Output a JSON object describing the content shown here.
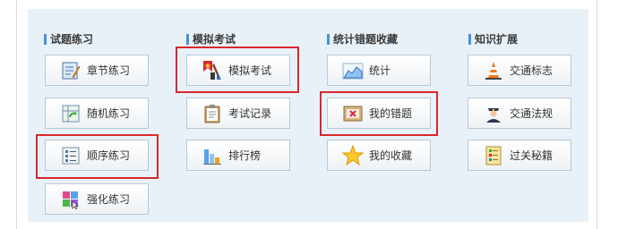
{
  "columns": [
    {
      "title": "试题练习",
      "buttons": [
        {
          "label": "章节练习",
          "icon": "notebook-pencil-icon"
        },
        {
          "label": "随机练习",
          "icon": "shuffle-sheet-icon"
        },
        {
          "label": "顺序练习",
          "icon": "list-icon"
        },
        {
          "label": "强化练习",
          "icon": "puzzle-blocks-icon"
        }
      ]
    },
    {
      "title": "模拟考试",
      "buttons": [
        {
          "label": "模拟考试",
          "icon": "exam-paintbrush-icon"
        },
        {
          "label": "考试记录",
          "icon": "clipboard-icon"
        },
        {
          "label": "排行榜",
          "icon": "bar-chart-icon"
        }
      ]
    },
    {
      "title": "统计错题收藏",
      "buttons": [
        {
          "label": "统计",
          "icon": "area-chart-icon"
        },
        {
          "label": "我的错题",
          "icon": "wrong-x-icon"
        },
        {
          "label": "我的收藏",
          "icon": "star-icon"
        }
      ]
    },
    {
      "title": "知识扩展",
      "buttons": [
        {
          "label": "交通标志",
          "icon": "traffic-cone-icon"
        },
        {
          "label": "交通法规",
          "icon": "police-officer-icon"
        },
        {
          "label": "过关秘籍",
          "icon": "checklist-book-icon"
        }
      ]
    }
  ],
  "colors": {
    "panel_bg": "#e8f1f8",
    "highlight": "#d9272e",
    "title_bar": "#4a90d9"
  }
}
